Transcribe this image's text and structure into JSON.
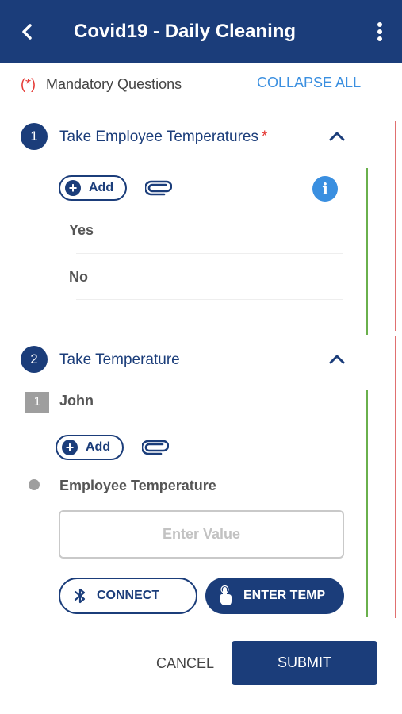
{
  "header": {
    "title": "Covid19 - Daily Cleaning",
    "back_icon": "chevron-left-icon",
    "menu_icon": "more-vertical-icon",
    "background": "#1b3d7a"
  },
  "mandatory_note": {
    "marker": "(*)",
    "text": "Mandatory Questions"
  },
  "collapse_all_label": "COLLAPSE ALL",
  "questions": [
    {
      "number": "1",
      "title": "Take Employee Temperatures",
      "required_marker": "*",
      "add_label": "Add",
      "options": [
        "Yes",
        "No"
      ]
    },
    {
      "number": "2",
      "title": "Take Temperature",
      "add_label": "Add",
      "subitem": {
        "number": "1",
        "name": "John"
      },
      "field_label": "Employee Temperature",
      "input": {
        "value": "",
        "placeholder": "Enter Value"
      },
      "connect_label": "CONNECT",
      "enter_temp_label": "ENTER TEMP"
    }
  ],
  "footer": {
    "cancel_label": "CANCEL",
    "submit_label": "SUBMIT"
  },
  "colors": {
    "primary": "#1b3d7a",
    "accent": "#3a8fe0",
    "required": "#e53935",
    "answered_line": "#6ab04c",
    "unanswered_line": "#e07070"
  }
}
